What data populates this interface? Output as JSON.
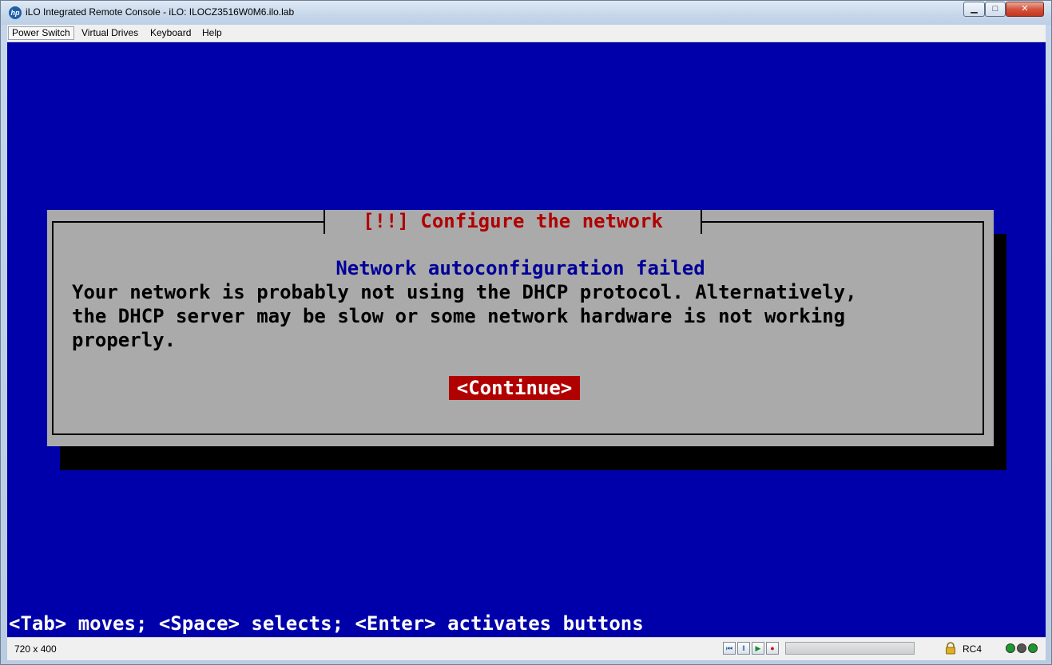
{
  "window": {
    "title": "iLO Integrated Remote Console - iLO: ILOCZ3516W0M6.ilo.lab",
    "app_icon": "hp-logo-icon",
    "controls": {
      "minimize": "minimize-icon",
      "maximize": "maximize-icon",
      "close": "close-icon"
    }
  },
  "menu": {
    "items": [
      {
        "label": "Power Switch"
      },
      {
        "label": "Virtual Drives"
      },
      {
        "label": "Keyboard"
      },
      {
        "label": "Help"
      }
    ]
  },
  "console": {
    "background": "#0000aa",
    "dialog": {
      "title": "[!!] Configure the network",
      "heading": "Network autoconfiguration failed",
      "body": "Your network is probably not using the DHCP protocol. Alternatively,\nthe DHCP server may be slow or some network hardware is not working\nproperly.",
      "button": "<Continue>"
    },
    "hint": "<Tab> moves; <Space> selects; <Enter> activates buttons"
  },
  "statusbar": {
    "resolution": "720 x 400",
    "playback_controls": [
      "skip-back-icon",
      "pause-icon",
      "play-icon",
      "record-icon"
    ],
    "encryption": "RC4",
    "indicators": [
      {
        "name": "green-status-icon",
        "color": "#1a9a2a"
      },
      {
        "name": "gray-status-icon",
        "color": "#555555"
      },
      {
        "name": "green-power-icon",
        "color": "#1a9a2a"
      }
    ]
  }
}
